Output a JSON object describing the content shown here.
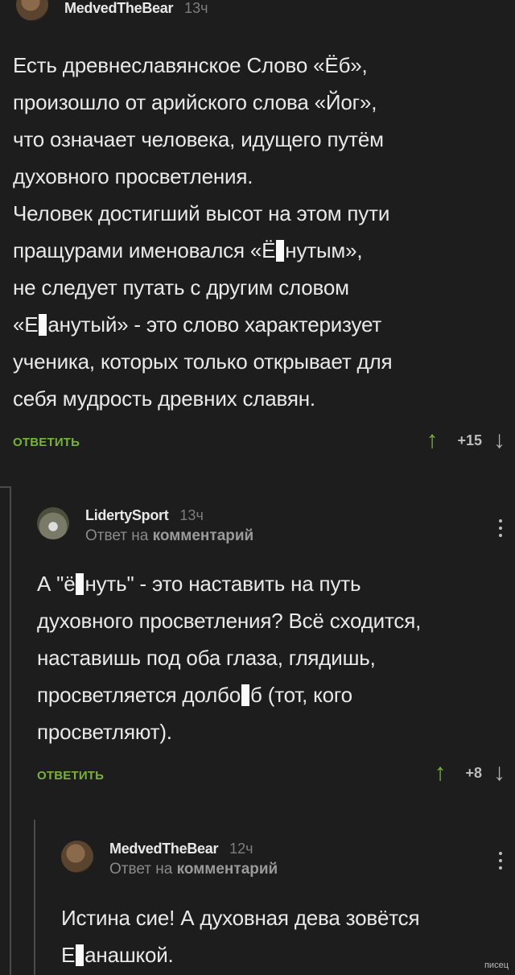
{
  "comments": [
    {
      "author": "MedvedTheBear",
      "time": "13ч",
      "text_lines": [
        "Есть древнеславянское Слово «Ёб»,",
        "произошло от арийского слова «Йог»,",
        "что означает человека, идущего путём",
        "духовного просветления.",
        "Человек достигший высот на этом пути",
        [
          "пращурами именовался «Ё",
          "нутым»,"
        ],
        "не следует путать с другим словом",
        [
          "«Е",
          "анутый» - это слово характеризует"
        ],
        "ученика, которых только открывает для",
        "себя мудрость древних славян."
      ],
      "reply_label": "ОТВЕТИТЬ",
      "score": "+15",
      "up_icon": "arrow-up-icon",
      "down_icon": "arrow-down-icon"
    },
    {
      "author": "LidertySport",
      "time": "13ч",
      "reply_prefix": "Ответ на",
      "reply_target": "комментарий",
      "text_lines": [
        [
          "А \"ё",
          "нуть\" - это наставить на путь"
        ],
        "духовного просветления? Всё сходится,",
        "наставишь под оба глаза, глядишь,",
        [
          "просветляется долбо",
          "б (тот, кого"
        ],
        "просветляют)."
      ],
      "reply_label": "ОТВЕТИТЬ",
      "score": "+8"
    },
    {
      "author": "MedvedTheBear",
      "time": "12ч",
      "reply_prefix": "Ответ на",
      "reply_target": "комментарий",
      "text_lines": [
        "Истина сие! А духовная дева зовётся",
        [
          "Е",
          "анашкой."
        ]
      ]
    }
  ],
  "watermark": "писец",
  "colors": {
    "background": "#1d1d1d",
    "accent": "#79b23b",
    "text": "#e9e9e9"
  }
}
